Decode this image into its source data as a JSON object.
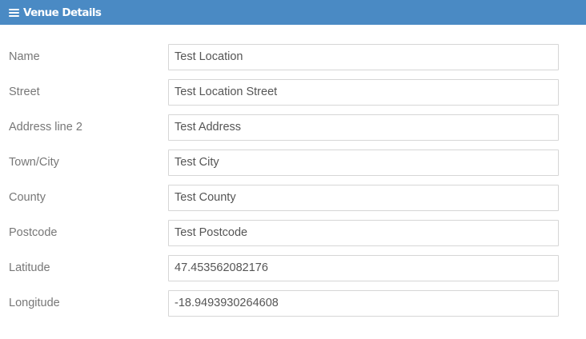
{
  "header": {
    "icon": "menu-icon",
    "title": "Venue Details",
    "background_color": "#4a8ac4"
  },
  "fields": [
    {
      "key": "name",
      "label": "Name",
      "value": "Test Location"
    },
    {
      "key": "street",
      "label": "Street",
      "value": "Test Location Street"
    },
    {
      "key": "address-line-2",
      "label": "Address line 2",
      "value": "Test Address"
    },
    {
      "key": "town-city",
      "label": "Town/City",
      "value": "Test City"
    },
    {
      "key": "county",
      "label": "County",
      "value": "Test County"
    },
    {
      "key": "postcode",
      "label": "Postcode",
      "value": "Test Postcode"
    },
    {
      "key": "latitude",
      "label": "Latitude",
      "value": "47.453562082176"
    },
    {
      "key": "longitude",
      "label": "Longitude",
      "value": "-18.9493930264608"
    }
  ]
}
